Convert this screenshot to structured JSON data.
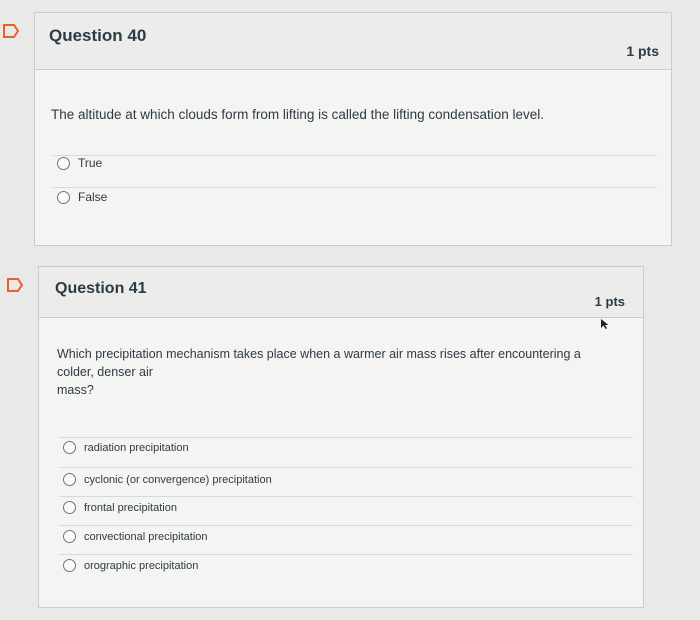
{
  "questions": [
    {
      "title": "Question 40",
      "points": "1 pts",
      "text": "The altitude at which clouds form from lifting is called the lifting condensation level.",
      "options": [
        "True",
        "False"
      ]
    },
    {
      "title": "Question 41",
      "points": "1 pts",
      "text_lines": [
        "Which precipitation mechanism takes place when a warmer air mass rises after encountering a",
        "colder, denser air",
        "mass?"
      ],
      "options": [
        "radiation precipitation",
        "cyclonic (or convergence) precipitation",
        "frontal precipitation",
        "convectional precipitation",
        "orographic precipitation"
      ]
    }
  ],
  "colors": {
    "flag": "#e8612c",
    "text": "#2d3b45",
    "border": "#c7cdd1"
  },
  "icons": {
    "flag": "bookmark-flag-icon",
    "cursor": "mouse-cursor-icon"
  }
}
